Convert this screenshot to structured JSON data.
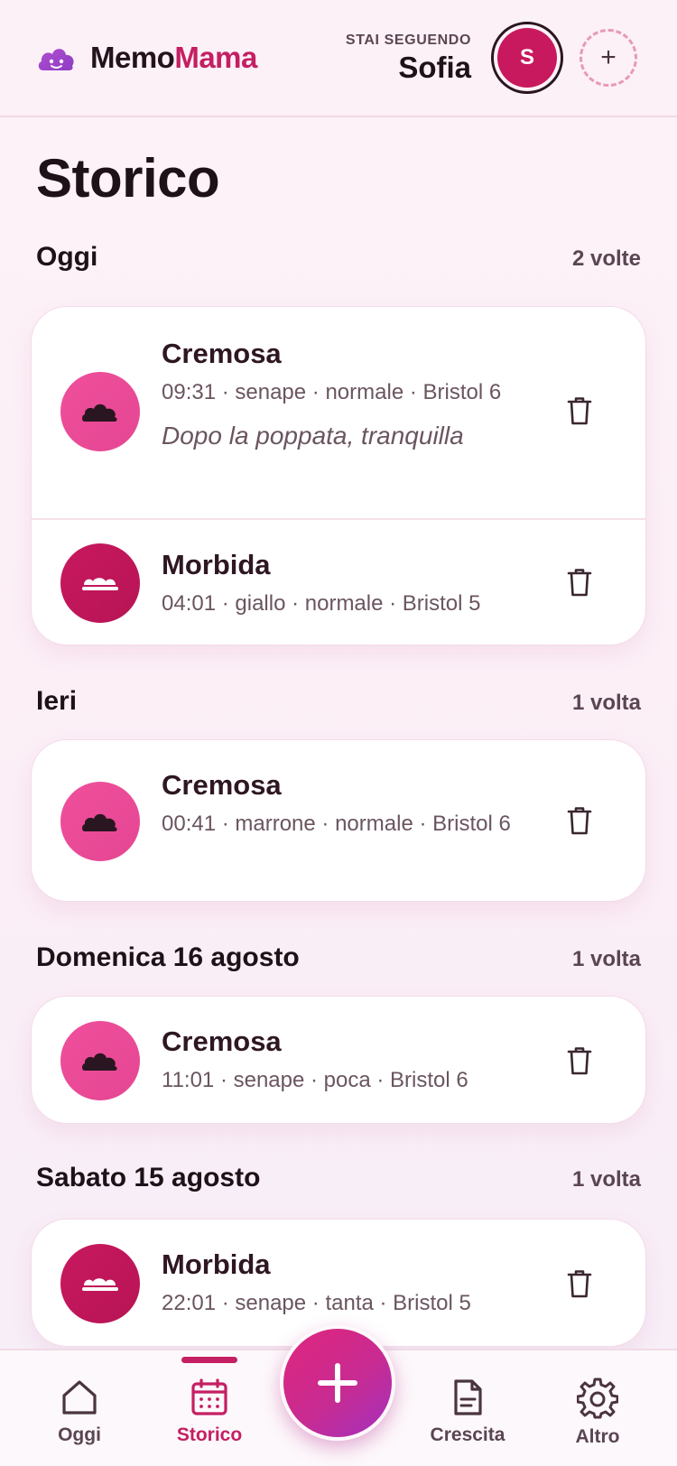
{
  "header": {
    "brand_part1": "Memo",
    "brand_part2": "Mama",
    "following_label": "STAI SEGUENDO",
    "following_name": "Sofia",
    "avatar_initial": "S",
    "add_child_glyph": "+"
  },
  "page_title": "Storico",
  "sections": [
    {
      "title": "Oggi",
      "count": "2 volte",
      "entries": [
        {
          "title": "Cremosa",
          "meta": "09:31 · senape · normale · Bristol 6",
          "note": "Dopo la poppata, tranquilla",
          "icon": "cloud-icon"
        },
        {
          "title": "Morbida",
          "meta": "04:01 · giallo · normale · Bristol 5",
          "icon": "soft-pile-icon"
        }
      ]
    },
    {
      "title": "Ieri",
      "count": "1 volta",
      "entries": [
        {
          "title": "Cremosa",
          "meta": "00:41 · marrone · normale · Bristol 6",
          "icon": "cloud-icon"
        }
      ]
    },
    {
      "title": "Domenica 16 agosto",
      "count": "1 volta",
      "entries": [
        {
          "title": "Cremosa",
          "meta": "11:01 · senape · poca · Bristol 6",
          "icon": "cloud-icon"
        }
      ]
    },
    {
      "title": "Sabato 15 agosto",
      "count": "1 volta",
      "entries": [
        {
          "title": "Morbida",
          "meta": "22:01 · senape · tanta · Bristol 5",
          "icon": "soft-pile-icon"
        }
      ]
    }
  ],
  "nav": {
    "today": "Oggi",
    "history": "Storico",
    "growth": "Crescita",
    "more": "Altro"
  },
  "colors": {
    "accent": "#c41f63",
    "icon_light": "#ec4c98",
    "icon_dark": "#c8185e"
  }
}
